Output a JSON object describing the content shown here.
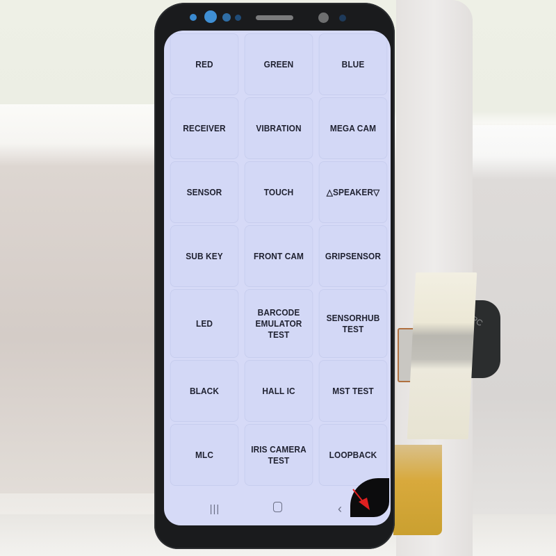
{
  "screen": {
    "test_menu": {
      "items": [
        "RED",
        "GREEN",
        "BLUE",
        "RECEIVER",
        "VIBRATION",
        "MEGA CAM",
        "SENSOR",
        "TOUCH",
        "△SPEAKER▽",
        "SUB KEY",
        "FRONT CAM",
        "GRIPSENSOR",
        "LED",
        "BARCODE EMULATOR TEST",
        "SENSORHUB TEST",
        "BLACK",
        "HALL IC",
        "MST TEST",
        "MLC",
        "IRIS CAMERA TEST",
        "LOOPBACK"
      ]
    },
    "navbar": {
      "recents_icon": "recents-icon",
      "home_icon": "home-icon",
      "back_icon": "back-icon",
      "recents_glyph": "|||",
      "back_glyph": "‹"
    }
  },
  "photo": {
    "cable_label": "PC",
    "annotation": {
      "type": "red-arrow",
      "color": "#e02020",
      "points_to": "damaged bottom-right screen corner"
    }
  },
  "colors": {
    "screen_bg": "#d6daf7",
    "cell_bg": "#d3d8f6",
    "label_text": "#1f2130",
    "bezel": "#1a1b1d",
    "front_camera_blue": "#3f8fd4"
  }
}
